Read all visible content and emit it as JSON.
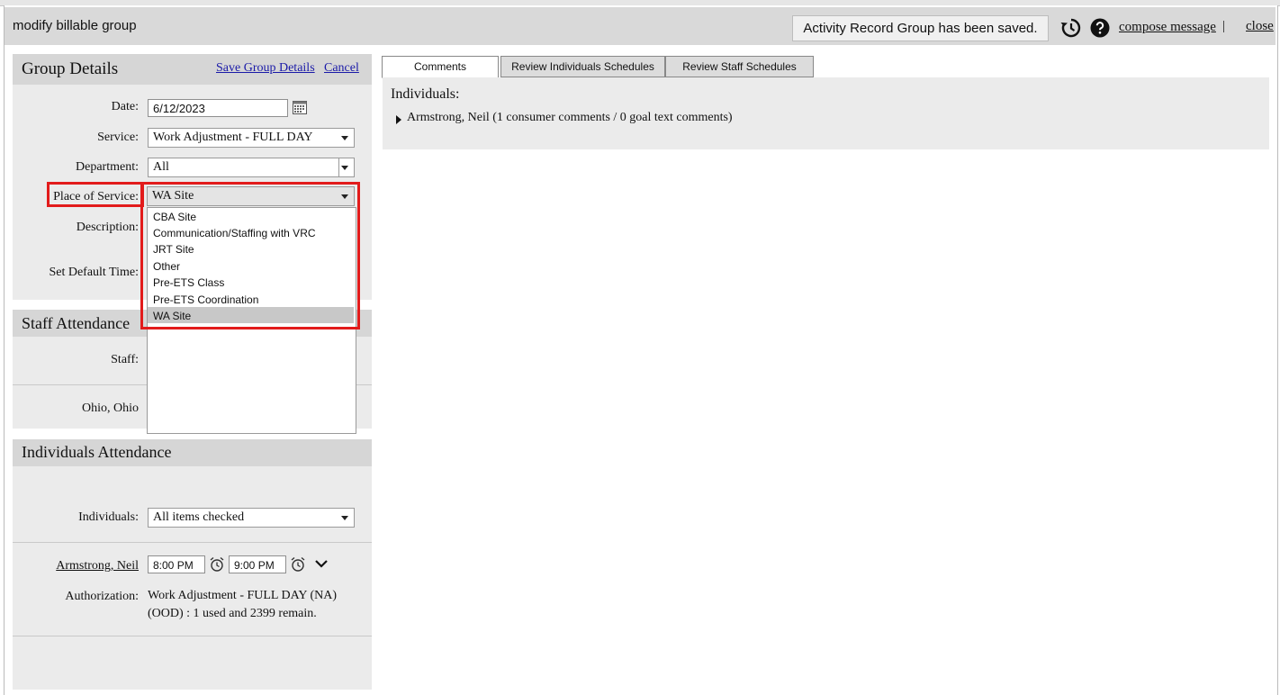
{
  "window": {
    "title": "modify billable group",
    "saved_message": "Activity Record Group has been saved.",
    "compose_label": "compose message",
    "pipe": "|",
    "close_label": "close"
  },
  "group_details": {
    "heading": "Group Details",
    "save_label": "Save Group Details",
    "cancel_label": "Cancel",
    "date_label": "Date:",
    "date_value": "6/12/2023",
    "service_label": "Service:",
    "service_value": "Work Adjustment - FULL DAY",
    "department_label": "Department:",
    "department_value": "All",
    "place_label": "Place of Service:",
    "place_value": "WA Site",
    "description_label": "Description:",
    "default_time_label": "Set Default Time:"
  },
  "place_options": [
    "CBA Site",
    "Communication/Staffing with VRC",
    "JRT Site",
    "Other",
    "Pre-ETS Class",
    "Pre-ETS Coordination",
    "WA Site"
  ],
  "place_selected_index": 6,
  "staff_attendance": {
    "heading": "Staff Attendance",
    "staff_label": "Staff:",
    "location_label": "Ohio, Ohio"
  },
  "individuals_attendance": {
    "heading": "Individuals Attendance",
    "individuals_label": "Individuals:",
    "individuals_value": "All items checked",
    "person_name": "Armstrong, Neil",
    "start_time": "8:00 PM",
    "end_time": "9:00 PM",
    "authorization_label": "Authorization:",
    "authorization_line1": "Work Adjustment - FULL DAY (NA)",
    "authorization_line2": "(OOD) : 1 used and 2399 remain."
  },
  "tabs": [
    "Comments",
    "Review Individuals Schedules",
    "Review Staff Schedules"
  ],
  "comments": {
    "heading": "Individuals:",
    "entry": "Armstrong, Neil (1 consumer comments / 0  goal text comments)"
  }
}
